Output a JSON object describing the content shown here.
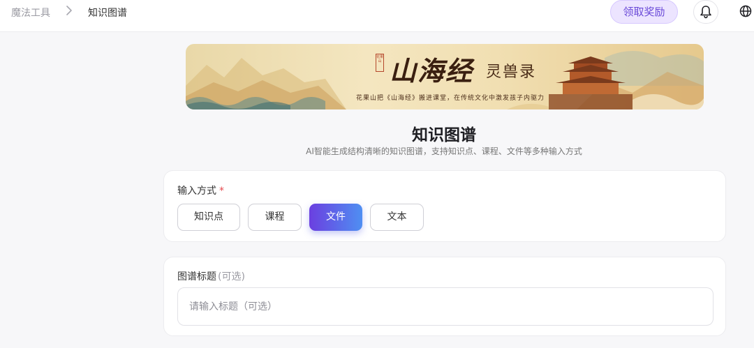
{
  "breadcrumb": {
    "root": "魔法工具",
    "current": "知识图谱"
  },
  "header": {
    "reward_label": "领取奖励",
    "bell_icon": "bell-icon",
    "globe_icon": "globe-icon"
  },
  "banner": {
    "seal": "花果山",
    "title": "山海经",
    "subtitle": "灵兽录",
    "tagline": "花果山把《山海经》搬进课堂，在传统文化中激发孩子内驱力"
  },
  "page": {
    "title": "知识图谱",
    "description": "AI智能生成结构清晰的知识图谱，支持知识点、课程、文件等多种输入方式"
  },
  "input_mode": {
    "label": "输入方式",
    "required_mark": "*",
    "options": [
      "知识点",
      "课程",
      "文件",
      "文本"
    ],
    "selected": "文件"
  },
  "graph_title": {
    "label": "图谱标题",
    "optional_hint": "(可选)",
    "placeholder": "请输入标题（可选）",
    "value": ""
  },
  "colors": {
    "accent_start": "#6b3fe0",
    "accent_end": "#4f8ff2",
    "reward_bg": "#ece4ff",
    "reward_text": "#6a4ad8",
    "required": "#e5484d"
  }
}
